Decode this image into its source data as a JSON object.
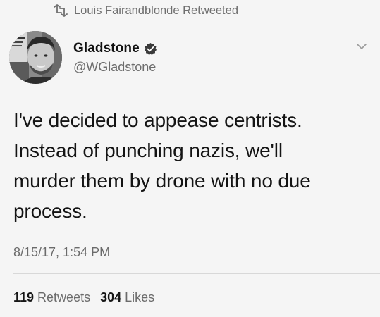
{
  "retweet": {
    "icon": "retweet-icon",
    "text": "Louis Fairandblonde Retweeted"
  },
  "author": {
    "display_name": "Gladstone",
    "handle": "@WGladstone",
    "verified_icon": "verified-badge-icon",
    "avatar": "avatar-photo"
  },
  "menu": {
    "icon": "chevron-down-icon"
  },
  "tweet": {
    "lines": [
      "I've decided to appease centrists.",
      "Instead of punching nazis, we'll",
      "murder them by drone with no due",
      "process."
    ],
    "timestamp": "8/15/17, 1:54 PM"
  },
  "stats": {
    "retweets_count": "119",
    "retweets_label": "Retweets",
    "likes_count": "304",
    "likes_label": "Likes"
  }
}
